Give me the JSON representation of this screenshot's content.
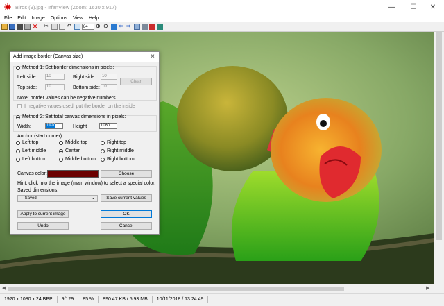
{
  "window": {
    "title": "Birds (9).jpg - IrfanView (Zoom: 1630 x 917)",
    "controls": [
      "—",
      "☐",
      "✕"
    ]
  },
  "menu": [
    "File",
    "Edit",
    "Image",
    "Options",
    "View",
    "Help"
  ],
  "toolbar": {
    "zoom_value": "84"
  },
  "dialog": {
    "title": "Add image border (Canvas size)",
    "method1": {
      "label": "Method 1: Set border dimensions in pixels:",
      "left_label": "Left side:",
      "left_value": "10",
      "right_label": "Right side:",
      "right_value": "10",
      "top_label": "Top side:",
      "top_value": "10",
      "bottom_label": "Bottom side:",
      "bottom_value": "10",
      "clear_label": "Clear"
    },
    "note": "Note: border values can be negative  numbers",
    "neg_checkbox": "If negative values used: put the border on the inside",
    "method2": {
      "label": "Method 2: Set total canvas dimensions in pixels:",
      "width_label": "Width:",
      "width_value": "1920",
      "height_label": "Height",
      "height_value": "1080"
    },
    "anchor": {
      "label": "Anchor (start corner)",
      "options": [
        "Left top",
        "Middle top",
        "Right top",
        "Left middle",
        "Center",
        "Right middle",
        "Left bottom",
        "Middle bottom",
        "Right bottom"
      ],
      "selected": "Center"
    },
    "canvas_color_label": "Canvas color:",
    "canvas_color": "#6b0000",
    "choose_label": "Choose",
    "hint": "Hint: click into the image (main window) to select a special color.",
    "saved_label": "Saved dimensions:",
    "saved_value": "--- Saved: ---",
    "save_current_label": "Save current values",
    "apply_label": "Apply to current image",
    "ok_label": "OK",
    "undo_label": "Undo",
    "cancel_label": "Cancel"
  },
  "status": [
    "1920 x 1080 x 24 BPP",
    "9/129",
    "85 %",
    "890.47 KB / 5.93 MB",
    "10/11/2018 / 13:24:49"
  ]
}
